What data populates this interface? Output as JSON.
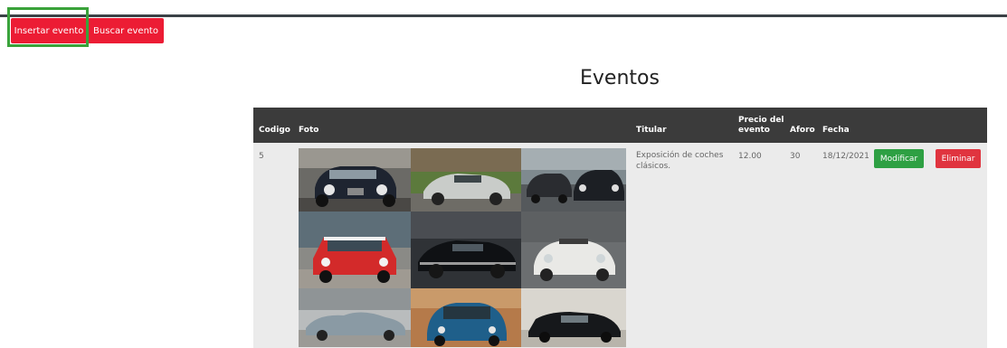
{
  "top_buttons": {
    "insert_label": "Insertar evento",
    "search_label": "Buscar evento"
  },
  "page_title": "Eventos",
  "table": {
    "headers": {
      "codigo": "Codigo",
      "foto": "Foto",
      "titular": "Titular",
      "precio_line1": "Precio del",
      "precio_line2": "evento",
      "aforo": "Aforo",
      "fecha": "Fecha"
    },
    "rows": [
      {
        "codigo": "5",
        "titular_line1": "Exposición de coches",
        "titular_line2": "clásicos.",
        "precio": "12.00",
        "aforo": "30",
        "fecha": "18/12/2021",
        "modify_label": "Modificar",
        "delete_label": "Eliminar",
        "photos": [
          "classic-car-dark-garage",
          "classic-car-silver-coupe",
          "classic-cars-road",
          "red-mini-cooper",
          "black-muscle-car",
          "white-vw-beetle-cabrio",
          "silver-jaguar-e-type",
          "blue-fiat-500",
          "classic-black-limousine"
        ]
      }
    ]
  },
  "colors": {
    "primary_red": "#ec1c34",
    "modify_green": "#2ea043",
    "delete_red": "#e0343f",
    "header_dark": "#3b3b3b",
    "focus_green": "#3aa23a"
  }
}
